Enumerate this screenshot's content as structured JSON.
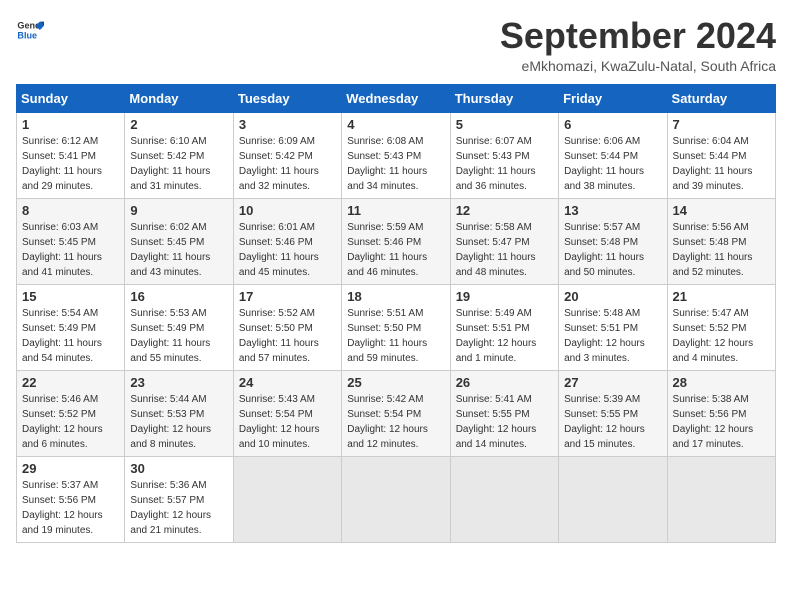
{
  "header": {
    "logo_general": "General",
    "logo_blue": "Blue",
    "month_title": "September 2024",
    "subtitle": "eMkhomazi, KwaZulu-Natal, South Africa"
  },
  "calendar": {
    "headers": [
      "Sunday",
      "Monday",
      "Tuesday",
      "Wednesday",
      "Thursday",
      "Friday",
      "Saturday"
    ],
    "weeks": [
      [
        {
          "day": "",
          "info": ""
        },
        {
          "day": "2",
          "info": "Sunrise: 6:10 AM\nSunset: 5:42 PM\nDaylight: 11 hours\nand 31 minutes."
        },
        {
          "day": "3",
          "info": "Sunrise: 6:09 AM\nSunset: 5:42 PM\nDaylight: 11 hours\nand 32 minutes."
        },
        {
          "day": "4",
          "info": "Sunrise: 6:08 AM\nSunset: 5:43 PM\nDaylight: 11 hours\nand 34 minutes."
        },
        {
          "day": "5",
          "info": "Sunrise: 6:07 AM\nSunset: 5:43 PM\nDaylight: 11 hours\nand 36 minutes."
        },
        {
          "day": "6",
          "info": "Sunrise: 6:06 AM\nSunset: 5:44 PM\nDaylight: 11 hours\nand 38 minutes."
        },
        {
          "day": "7",
          "info": "Sunrise: 6:04 AM\nSunset: 5:44 PM\nDaylight: 11 hours\nand 39 minutes."
        }
      ],
      [
        {
          "day": "1",
          "info": "Sunrise: 6:12 AM\nSunset: 5:41 PM\nDaylight: 11 hours\nand 29 minutes."
        },
        {
          "day": "2",
          "info": "Sunrise: 6:10 AM\nSunset: 5:42 PM\nDaylight: 11 hours\nand 31 minutes."
        },
        {
          "day": "3",
          "info": "Sunrise: 6:09 AM\nSunset: 5:42 PM\nDaylight: 11 hours\nand 32 minutes."
        },
        {
          "day": "4",
          "info": "Sunrise: 6:08 AM\nSunset: 5:43 PM\nDaylight: 11 hours\nand 34 minutes."
        },
        {
          "day": "5",
          "info": "Sunrise: 6:07 AM\nSunset: 5:43 PM\nDaylight: 11 hours\nand 36 minutes."
        },
        {
          "day": "6",
          "info": "Sunrise: 6:06 AM\nSunset: 5:44 PM\nDaylight: 11 hours\nand 38 minutes."
        },
        {
          "day": "7",
          "info": "Sunrise: 6:04 AM\nSunset: 5:44 PM\nDaylight: 11 hours\nand 39 minutes."
        }
      ],
      [
        {
          "day": "8",
          "info": "Sunrise: 6:03 AM\nSunset: 5:45 PM\nDaylight: 11 hours\nand 41 minutes."
        },
        {
          "day": "9",
          "info": "Sunrise: 6:02 AM\nSunset: 5:45 PM\nDaylight: 11 hours\nand 43 minutes."
        },
        {
          "day": "10",
          "info": "Sunrise: 6:01 AM\nSunset: 5:46 PM\nDaylight: 11 hours\nand 45 minutes."
        },
        {
          "day": "11",
          "info": "Sunrise: 5:59 AM\nSunset: 5:46 PM\nDaylight: 11 hours\nand 46 minutes."
        },
        {
          "day": "12",
          "info": "Sunrise: 5:58 AM\nSunset: 5:47 PM\nDaylight: 11 hours\nand 48 minutes."
        },
        {
          "day": "13",
          "info": "Sunrise: 5:57 AM\nSunset: 5:48 PM\nDaylight: 11 hours\nand 50 minutes."
        },
        {
          "day": "14",
          "info": "Sunrise: 5:56 AM\nSunset: 5:48 PM\nDaylight: 11 hours\nand 52 minutes."
        }
      ],
      [
        {
          "day": "15",
          "info": "Sunrise: 5:54 AM\nSunset: 5:49 PM\nDaylight: 11 hours\nand 54 minutes."
        },
        {
          "day": "16",
          "info": "Sunrise: 5:53 AM\nSunset: 5:49 PM\nDaylight: 11 hours\nand 55 minutes."
        },
        {
          "day": "17",
          "info": "Sunrise: 5:52 AM\nSunset: 5:50 PM\nDaylight: 11 hours\nand 57 minutes."
        },
        {
          "day": "18",
          "info": "Sunrise: 5:51 AM\nSunset: 5:50 PM\nDaylight: 11 hours\nand 59 minutes."
        },
        {
          "day": "19",
          "info": "Sunrise: 5:49 AM\nSunset: 5:51 PM\nDaylight: 12 hours\nand 1 minute."
        },
        {
          "day": "20",
          "info": "Sunrise: 5:48 AM\nSunset: 5:51 PM\nDaylight: 12 hours\nand 3 minutes."
        },
        {
          "day": "21",
          "info": "Sunrise: 5:47 AM\nSunset: 5:52 PM\nDaylight: 12 hours\nand 4 minutes."
        }
      ],
      [
        {
          "day": "22",
          "info": "Sunrise: 5:46 AM\nSunset: 5:52 PM\nDaylight: 12 hours\nand 6 minutes."
        },
        {
          "day": "23",
          "info": "Sunrise: 5:44 AM\nSunset: 5:53 PM\nDaylight: 12 hours\nand 8 minutes."
        },
        {
          "day": "24",
          "info": "Sunrise: 5:43 AM\nSunset: 5:54 PM\nDaylight: 12 hours\nand 10 minutes."
        },
        {
          "day": "25",
          "info": "Sunrise: 5:42 AM\nSunset: 5:54 PM\nDaylight: 12 hours\nand 12 minutes."
        },
        {
          "day": "26",
          "info": "Sunrise: 5:41 AM\nSunset: 5:55 PM\nDaylight: 12 hours\nand 14 minutes."
        },
        {
          "day": "27",
          "info": "Sunrise: 5:39 AM\nSunset: 5:55 PM\nDaylight: 12 hours\nand 15 minutes."
        },
        {
          "day": "28",
          "info": "Sunrise: 5:38 AM\nSunset: 5:56 PM\nDaylight: 12 hours\nand 17 minutes."
        }
      ],
      [
        {
          "day": "29",
          "info": "Sunrise: 5:37 AM\nSunset: 5:56 PM\nDaylight: 12 hours\nand 19 minutes."
        },
        {
          "day": "30",
          "info": "Sunrise: 5:36 AM\nSunset: 5:57 PM\nDaylight: 12 hours\nand 21 minutes."
        },
        {
          "day": "",
          "info": ""
        },
        {
          "day": "",
          "info": ""
        },
        {
          "day": "",
          "info": ""
        },
        {
          "day": "",
          "info": ""
        },
        {
          "day": "",
          "info": ""
        }
      ]
    ]
  }
}
